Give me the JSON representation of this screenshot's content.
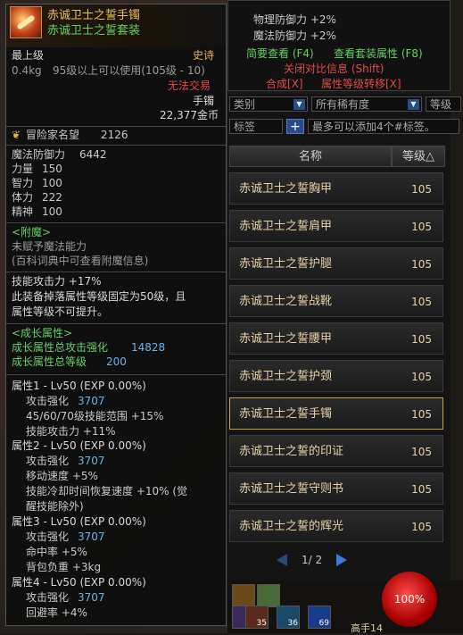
{
  "tooltip": {
    "item_name": "赤诚卫士之誓手镯",
    "set_name": "赤诚卫士之誓套装",
    "level_req": "最上级",
    "rarity": "史诗",
    "weight": "0.4kg",
    "usable_level": "95级以上可以使用(105级 - 10)",
    "trade": "无法交易",
    "slot": "手镯",
    "price": "22,377金币",
    "fame_label": "冒险家名望",
    "fame_value": "2126",
    "stats": [
      {
        "label": "魔法防御力",
        "value": "6442"
      },
      {
        "label": "力量",
        "value": "150"
      },
      {
        "label": "智力",
        "value": "100"
      },
      {
        "label": "体力",
        "value": "222"
      },
      {
        "label": "精神",
        "value": "100"
      }
    ],
    "enchant_header": "<附魔>",
    "enchant_line1": "未赋予魔法能力",
    "enchant_line2": "(百科词典中可查看附魔信息)",
    "skill_atk": "技能攻击力 +17%",
    "fixed_line1": "此装备掉落属性等级固定为50级，且",
    "fixed_line2": "属性等级不可提升。",
    "growth_header": "<成长属性>",
    "growth_total_label": "成长属性总攻击强化",
    "growth_total_value": "14828",
    "growth_level_label": "成长属性总等级",
    "growth_level_value": "200",
    "attr1_title": "属性1 - Lv50 (EXP 0.00%)",
    "attr1_l1_label": "攻击强化",
    "attr1_l1_value": "3707",
    "attr1_l2": "45/60/70级技能范围 +15%",
    "attr1_l3": "技能攻击力 +11%",
    "attr2_title": "属性2 - Lv50 (EXP 0.00%)",
    "attr2_l1_label": "攻击强化",
    "attr2_l1_value": "3707",
    "attr2_l2": "移动速度 +5%",
    "attr2_l3": "技能冷却时间恢复速度 +10% (觉",
    "attr2_l4": "醒技能除外)",
    "attr3_title": "属性3 - Lv50 (EXP 0.00%)",
    "attr3_l1_label": "攻击强化",
    "attr3_l1_value": "3707",
    "attr3_l2": "命中率 +5%",
    "attr3_l3": "背包负重 +3kg",
    "attr4_title": "属性4 - Lv50 (EXP 0.00%)",
    "attr4_l1_label": "攻击强化",
    "attr4_l1_value": "3707",
    "attr4_l2": "回避率 +4%"
  },
  "set_panel": {
    "phys_def": "物理防御力 +2%",
    "mag_def": "魔法防御力 +2%",
    "brief_view": "简要查看 (F4)",
    "set_attr_view": "查看套装属性 (F8)",
    "close_compare": "关闭对比信息 (Shift)",
    "synthesize": "合成[X]",
    "transfer": "属性等级转移[X]"
  },
  "filters": {
    "category": "类别",
    "rarity": "所有稀有度",
    "level": "等级",
    "tag": "标签",
    "tag_placeholder": "最多可以添加4个#标签。"
  },
  "list": {
    "col_name": "名称",
    "col_level": "等级△",
    "items": [
      {
        "name": "赤诚卫士之誓胸甲",
        "level": "105"
      },
      {
        "name": "赤诚卫士之誓肩甲",
        "level": "105"
      },
      {
        "name": "赤诚卫士之誓护腿",
        "level": "105"
      },
      {
        "name": "赤诚卫士之誓战靴",
        "level": "105"
      },
      {
        "name": "赤诚卫士之誓腰甲",
        "level": "105"
      },
      {
        "name": "赤诚卫士之誓护颈",
        "level": "105"
      },
      {
        "name": "赤诚卫士之誓手镯",
        "level": "105"
      },
      {
        "name": "赤诚卫士之誓的印证",
        "level": "105"
      },
      {
        "name": "赤诚卫士之誓守则书",
        "level": "105"
      },
      {
        "name": "赤诚卫士之誓的辉光",
        "level": "105"
      }
    ],
    "page": "1/ 2"
  },
  "hud": {
    "hp": "100%",
    "hotbar_counts": [
      "5",
      "35",
      "36",
      "69"
    ],
    "name_partial": "高手14"
  }
}
